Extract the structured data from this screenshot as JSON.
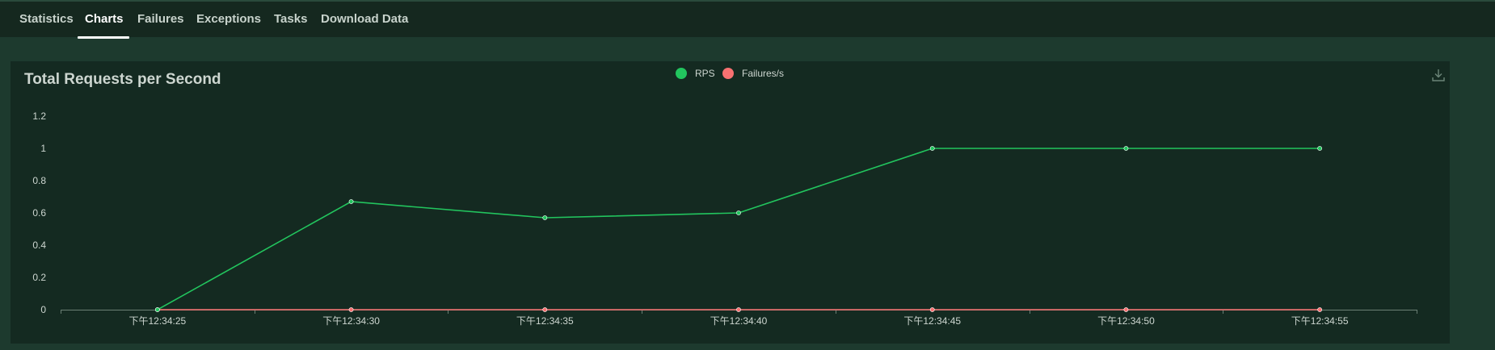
{
  "nav": {
    "tabs": [
      {
        "label": "Statistics",
        "active": false
      },
      {
        "label": "Charts",
        "active": true
      },
      {
        "label": "Failures",
        "active": false
      },
      {
        "label": "Exceptions",
        "active": false
      },
      {
        "label": "Tasks",
        "active": false
      },
      {
        "label": "Download Data",
        "active": false
      }
    ]
  },
  "colors": {
    "rps": "#22c55e",
    "failures": "#f87171",
    "background": "#1d3a2e",
    "panel": "#142a21",
    "navbar": "#15281f",
    "text": "#cdd6d0"
  },
  "download_icon": "download-icon",
  "chart_data": {
    "type": "line",
    "title": "Total Requests per Second",
    "categories": [
      "下午12:34:25",
      "下午12:34:30",
      "下午12:34:35",
      "下午12:34:40",
      "下午12:34:45",
      "下午12:34:50",
      "下午12:34:55"
    ],
    "series": [
      {
        "name": "RPS",
        "values": [
          0,
          0.67,
          0.57,
          0.6,
          1,
          1,
          1
        ]
      },
      {
        "name": "Failures/s",
        "values": [
          0,
          0,
          0,
          0,
          0,
          0,
          0
        ]
      }
    ],
    "yticks": [
      "0",
      "0.2",
      "0.4",
      "0.6",
      "0.8",
      "1",
      "1.2"
    ],
    "ylim": [
      0,
      1.2
    ],
    "legend": "top-center",
    "grid": false
  }
}
